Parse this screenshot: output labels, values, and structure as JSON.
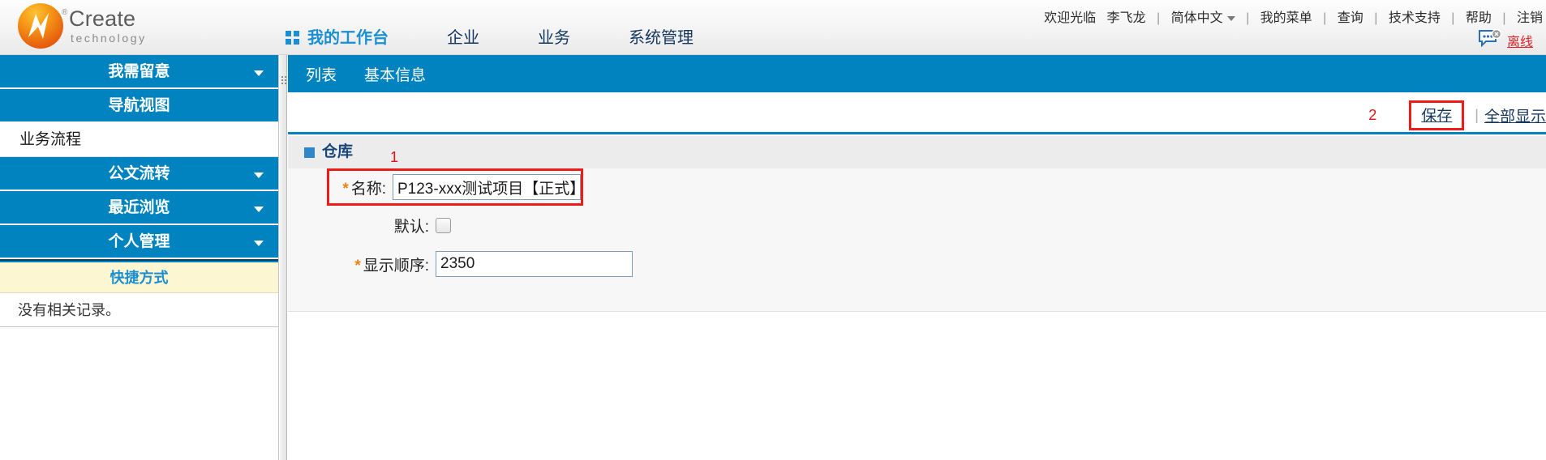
{
  "brand": {
    "name": "Create",
    "registered": "®",
    "tagline": "technology",
    "logo_icon": "create-lightning-logo",
    "accent_blue": "#0083bf",
    "accent_orange": "#e8610f"
  },
  "header": {
    "welcome_text": "欢迎光临",
    "user_name": "李飞龙",
    "language": "简体中文",
    "links": [
      {
        "label": "我的菜单"
      },
      {
        "label": "查询"
      },
      {
        "label": "技术支持"
      },
      {
        "label": "帮助"
      },
      {
        "label": "注销"
      }
    ],
    "separator": "|",
    "offline_label": "离线",
    "offline_icon": "chat-bubble-offline-icon",
    "offline_color": "#e31e24"
  },
  "main_nav": {
    "items": [
      {
        "label": "我的工作台",
        "active": true,
        "icon": "grid-dots-icon"
      },
      {
        "label": "企业",
        "active": false
      },
      {
        "label": "业务",
        "active": false
      },
      {
        "label": "系统管理",
        "active": false
      }
    ]
  },
  "sidebar": {
    "accordion": [
      {
        "label": "我需留意",
        "open": false,
        "caret": true
      },
      {
        "label": "导航视图",
        "open": false,
        "caret": false
      },
      {
        "label": "业务流程",
        "open": true,
        "caret": false
      },
      {
        "label": "公文流转",
        "open": false,
        "caret": true
      },
      {
        "label": "最近浏览",
        "open": false,
        "caret": true
      },
      {
        "label": "个人管理",
        "open": false,
        "caret": true
      }
    ],
    "shortcut": {
      "title": "快捷方式",
      "empty_text": "没有相关记录。"
    },
    "splitter_icon": "splitter-grip-icon"
  },
  "content": {
    "tabs": [
      {
        "label": "列表"
      },
      {
        "label": "基本信息"
      }
    ],
    "toolbar": {
      "annotation_2": "2",
      "save_label": "保存",
      "separator": "|",
      "show_all_label": "全部显示",
      "highlight_color": "#ef1b16"
    },
    "panel": {
      "title": "仓库",
      "annotation_1": "1",
      "bullet_icon": "square-bullet-icon",
      "fields": [
        {
          "label": "名称:",
          "required": true,
          "required_mark": "*",
          "type": "text",
          "value": "P123-xxx测试项目【正式】",
          "placeholder": "",
          "highlighted": true
        },
        {
          "label": "默认:",
          "required": false,
          "required_mark": "",
          "type": "checkbox",
          "checked": false
        },
        {
          "label": "显示顺序:",
          "required": true,
          "required_mark": "*",
          "type": "text",
          "value": "2350",
          "placeholder": ""
        }
      ]
    }
  }
}
